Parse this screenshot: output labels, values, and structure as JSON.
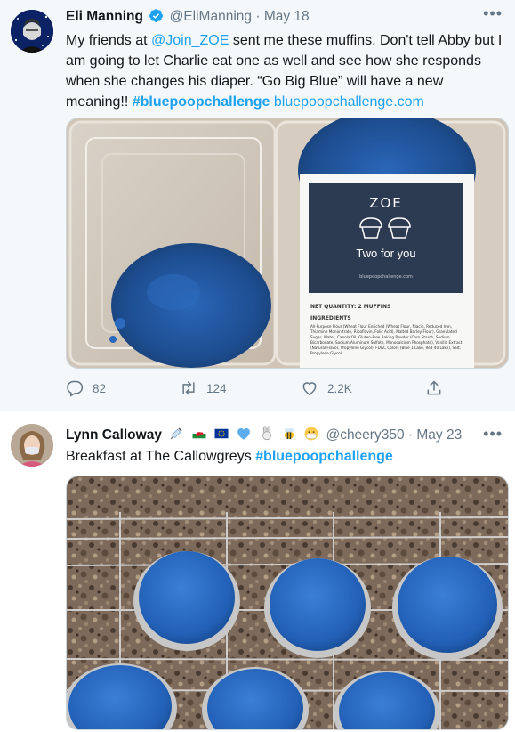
{
  "tweets": [
    {
      "author_name": "Eli Manning",
      "handle": "@EliManning",
      "separator": "·",
      "date": "May 18",
      "text_plain_1": "My friends at ",
      "mention": "@Join_ZOE",
      "text_plain_2": " sent me these muffins. Don't tell Abby but I am going to let Charlie eat one as well and see how she responds when she changes his diaper. “Go Big Blue” will have a new meaning!! ",
      "hashtag": "#bluepoopchallenge",
      "url": "bluepoopchallenge.com",
      "package": {
        "brand": "ZOE",
        "subtitle": "Two for you",
        "site": "bluepoopchallenge.com",
        "net_quantity": "NET QUANTITY: 2 MUFFINS",
        "ingredients_heading": "INGREDIENTS",
        "ingredients_text": "All-Purpose Flour (Wheat Flour Enriched (Wheat Flour, Niacin, Reduced Iron, Thiamine Mononitrate, Riboflavin, Folic Acid), Malted Barley Flour), Granulated Sugar, Water, Canola Oil, Gluten-Free Baking Powder (Corn Starch, Sodium Bicarbonate, Sodium Aluminum Sulfate, Monocalcium Phosphate), Vanilla Extract (Natural Flavor, Propylene Glycol), FD&C Colors (Blue 1 Lake, Red 40 Lake), Salt, Propylene Glycol"
      },
      "stats": {
        "replies": "82",
        "retweets": "124",
        "likes": "2.2K"
      }
    },
    {
      "author_name": "Lynn Calloway",
      "handle": "@cheery350",
      "separator": "·",
      "date": "May 23",
      "text_plain": "Breakfast at The Callowgreys ",
      "hashtag": "#bluepoopchallenge"
    }
  ],
  "more_icon": "more-dots-icon",
  "icons": [
    "reply-icon",
    "retweet-icon",
    "like-icon",
    "share-icon",
    "verified-badge-icon"
  ],
  "colors": {
    "link": "#1da1f2",
    "muted": "#657786",
    "muffin_blue": "#1f5fb8"
  }
}
